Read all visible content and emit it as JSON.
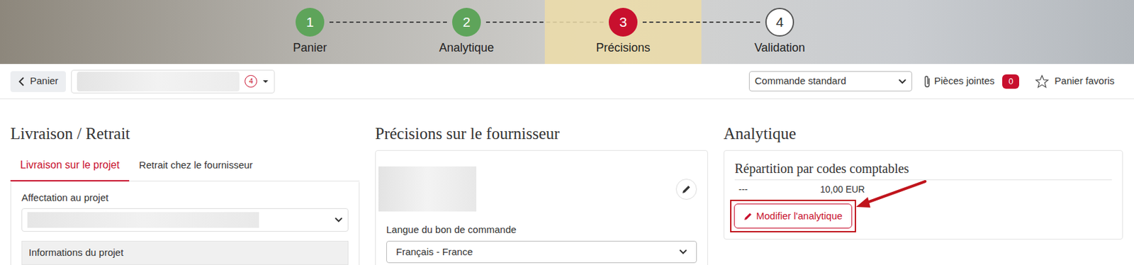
{
  "steps": [
    {
      "number": "1",
      "label": "Panier",
      "kind": "done"
    },
    {
      "number": "2",
      "label": "Analytique",
      "kind": "done"
    },
    {
      "number": "3",
      "label": "Précisions",
      "kind": "current"
    },
    {
      "number": "4",
      "label": "Validation",
      "kind": "todo"
    }
  ],
  "toolbar": {
    "back": "Panier",
    "cart_badge": "4",
    "order_type": "Commande standard",
    "attachments": {
      "label": "Pièces jointes",
      "count": "0"
    },
    "favorites": "Panier favoris"
  },
  "delivery": {
    "title": "Livraison / Retrait",
    "tabs": [
      {
        "label": "Livraison sur le projet",
        "selected": true
      },
      {
        "label": "Retrait chez le fournisseur",
        "selected": false
      }
    ],
    "project_label": "Affectation au projet",
    "project_info": "Informations du projet"
  },
  "supplier": {
    "title": "Précisions sur le fournisseur",
    "language_label": "Langue du bon de commande",
    "language": "Français - France"
  },
  "analytics": {
    "title": "Analytique",
    "subtitle": "Répartition par codes comptables",
    "rows": [
      {
        "code": "---",
        "amount": "10,00 EUR"
      }
    ],
    "button": "Modifier l'analytique"
  }
}
